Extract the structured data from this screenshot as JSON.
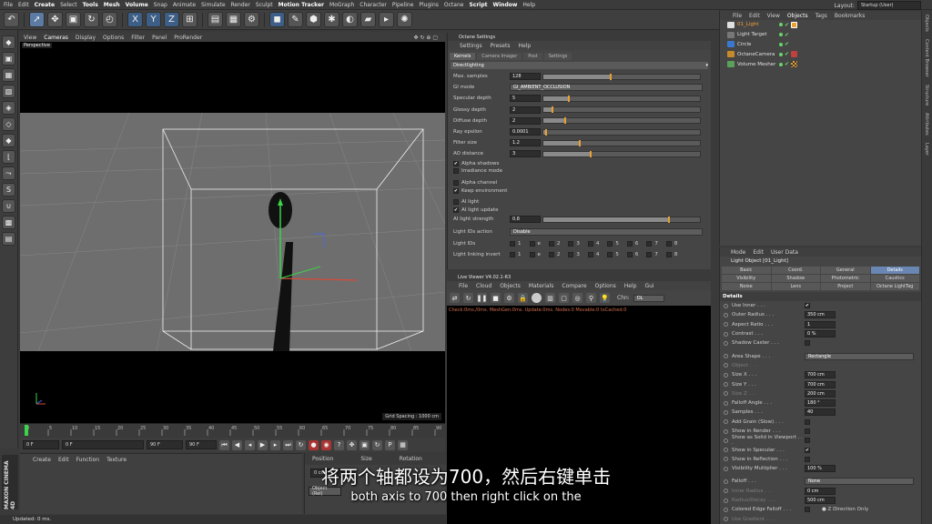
{
  "menubar": {
    "items": [
      "File",
      "Edit",
      "Create",
      "Select",
      "Tools",
      "Mesh",
      "Volume",
      "Snap",
      "Animate",
      "Simulate",
      "Render",
      "Sculpt",
      "Motion Tracker",
      "MoGraph",
      "Character",
      "Pipeline",
      "Plugins",
      "Octane",
      "Script",
      "Window",
      "Help"
    ],
    "layout_label": "Layout:",
    "layout_value": "Startup (User)"
  },
  "viewport": {
    "menu": [
      "View",
      "Cameras",
      "Display",
      "Options",
      "Filter",
      "Panel",
      "ProRender"
    ],
    "label": "Perspective",
    "grid_spacing": "Grid Spacing : 1000 cm"
  },
  "transport": {
    "start": "0 F",
    "current": "0 F",
    "end_a": "90 F",
    "end_b": "90 F"
  },
  "timeline": {
    "ticks": [
      "0",
      "5",
      "10",
      "15",
      "20",
      "25",
      "30",
      "35",
      "40",
      "45",
      "50",
      "55",
      "60",
      "65",
      "70",
      "75",
      "80",
      "85",
      "90"
    ]
  },
  "material_manager": {
    "menu": [
      "Create",
      "Edit",
      "Function",
      "Texture"
    ]
  },
  "coordinates": {
    "headers": [
      "Position",
      "Size",
      "Rotation"
    ],
    "first_value": "0 cm",
    "dropdown": "Object (Rel)"
  },
  "octane_settings": {
    "title": "Octane Settings",
    "menu": [
      "Settings",
      "Presets",
      "Help"
    ],
    "tabs": [
      "Kernels",
      "Camera Imager",
      "Post",
      "Settings"
    ],
    "section": "Directlighting",
    "params": [
      {
        "label": "Max. samples",
        "value": "128",
        "fill": 0.43,
        "knob": true
      },
      {
        "label": "GI mode",
        "dropdown": "GI_AMBIENT_OCCLUSION"
      },
      {
        "label": "Specular depth",
        "value": "5",
        "fill": 0.16
      },
      {
        "label": "Glossy depth",
        "value": "2",
        "fill": 0.06
      },
      {
        "label": "Diffuse depth",
        "value": "2",
        "fill": 0.14
      },
      {
        "label": "Ray epsilon",
        "value": "0.0001",
        "fill": 0.02
      },
      {
        "label": "Filter size",
        "value": "1.2",
        "fill": 0.23
      },
      {
        "label": "AO distance",
        "value": "3",
        "fill": 0.3
      }
    ],
    "checks": [
      {
        "label": "Alpha shadows",
        "checked": true
      },
      {
        "label": "Irradiance mode",
        "checked": false
      },
      {
        "label": "Alpha channel",
        "checked": false
      },
      {
        "label": "Keep environment",
        "checked": true
      },
      {
        "label": "AI light",
        "checked": false
      },
      {
        "label": "AI light update",
        "checked": true
      }
    ],
    "ai_strength": {
      "label": "AI light strength",
      "value": "0.8",
      "fill": 0.8
    },
    "light_ids_action": {
      "label": "Light IDs action",
      "value": "Disable"
    },
    "light_ids": {
      "label": "Light IDs",
      "items": [
        "1",
        "e",
        "2",
        "3",
        "4",
        "5",
        "6",
        "7",
        "8"
      ]
    },
    "light_linking": {
      "label": "Light linking invert",
      "items": [
        "1",
        "e",
        "2",
        "3",
        "4",
        "5",
        "6",
        "7",
        "8"
      ]
    }
  },
  "live_viewer": {
    "title": "Live Viewer V4.02.1-R3",
    "menu": [
      "File",
      "Cloud",
      "Objects",
      "Materials",
      "Compare",
      "Options",
      "Help",
      "Gui"
    ],
    "chan_label": "Chn:",
    "chan_value": "DL",
    "status": "Check:0ms./0ms. MeshGen:0ms. Update:0ms. Nodes:0 Movable:0 txCached:0"
  },
  "object_manager": {
    "menu": [
      "File",
      "Edit",
      "View",
      "Objects",
      "Tags",
      "Bookmarks"
    ],
    "objects": [
      "01_Light",
      "Light Target",
      "Circle",
      "OctaneCamera",
      "Volume Mesher"
    ]
  },
  "attributes": {
    "menu": [
      "Mode",
      "Edit",
      "User Data"
    ],
    "object": "Light Object [01_Light]",
    "tabs": [
      "Basic",
      "Coord.",
      "General",
      "Details",
      "Visibility",
      "Shadow",
      "Photometric",
      "Caustics",
      "Noise",
      "Lens",
      "Project",
      "Octane LightTag"
    ],
    "header": "Details",
    "rows": [
      {
        "label": "Use Inner",
        "check": true
      },
      {
        "label": "Outer Radius",
        "value": "350 cm"
      },
      {
        "label": "Aspect Ratio",
        "value": "1"
      },
      {
        "label": "Contrast",
        "value": "0 %"
      },
      {
        "label": "Shadow Caster",
        "check": false
      },
      {
        "label": "",
        "spacer": true
      },
      {
        "label": "Area Shape",
        "dropdown": "Rectangle"
      },
      {
        "label": "Object",
        "dim": true
      },
      {
        "label": "Size X",
        "value": "700 cm"
      },
      {
        "label": "Size Y",
        "value": "700 cm"
      },
      {
        "label": "Size Z",
        "value": "200 cm",
        "dim": true
      },
      {
        "label": "Falloff Angle",
        "value": "180 °"
      },
      {
        "label": "Samples",
        "value": "40"
      },
      {
        "label": "Add Grain (Slow)",
        "check": false
      },
      {
        "label": "Show in Render",
        "check": false
      },
      {
        "label": "Show as Solid in Viewport",
        "check": false
      },
      {
        "label": "Show in Specular",
        "check": true
      },
      {
        "label": "Show in Reflection",
        "check": false
      },
      {
        "label": "Visibility Multiplier",
        "value": "100 %"
      },
      {
        "label": "",
        "spacer": true
      },
      {
        "label": "Falloff",
        "dropdown": "None"
      },
      {
        "label": "Inner Radius",
        "value": "0 cm",
        "dim": true
      },
      {
        "label": "Radius/Decay",
        "value": "500 cm",
        "dim": true
      },
      {
        "label": "Colored Edge Falloff",
        "check": false,
        "extra": "Z Direction Only"
      },
      {
        "label": "Use Gradient",
        "dim": true
      }
    ]
  },
  "right_strip": [
    "Objects",
    "Content Browser",
    "Structure",
    "Attributes",
    "Layer"
  ],
  "status_bar": "Updated: 0 ms.",
  "logo": "MAXON CINEMA 4D",
  "subtitles": {
    "zh": "将两个轴都设为700，然后右键单击",
    "en": "both axis to 700 then right click on the"
  },
  "colors": {
    "accent": "#e8a030",
    "selected": "#6a87b3",
    "live_status": "#d06a4a"
  }
}
